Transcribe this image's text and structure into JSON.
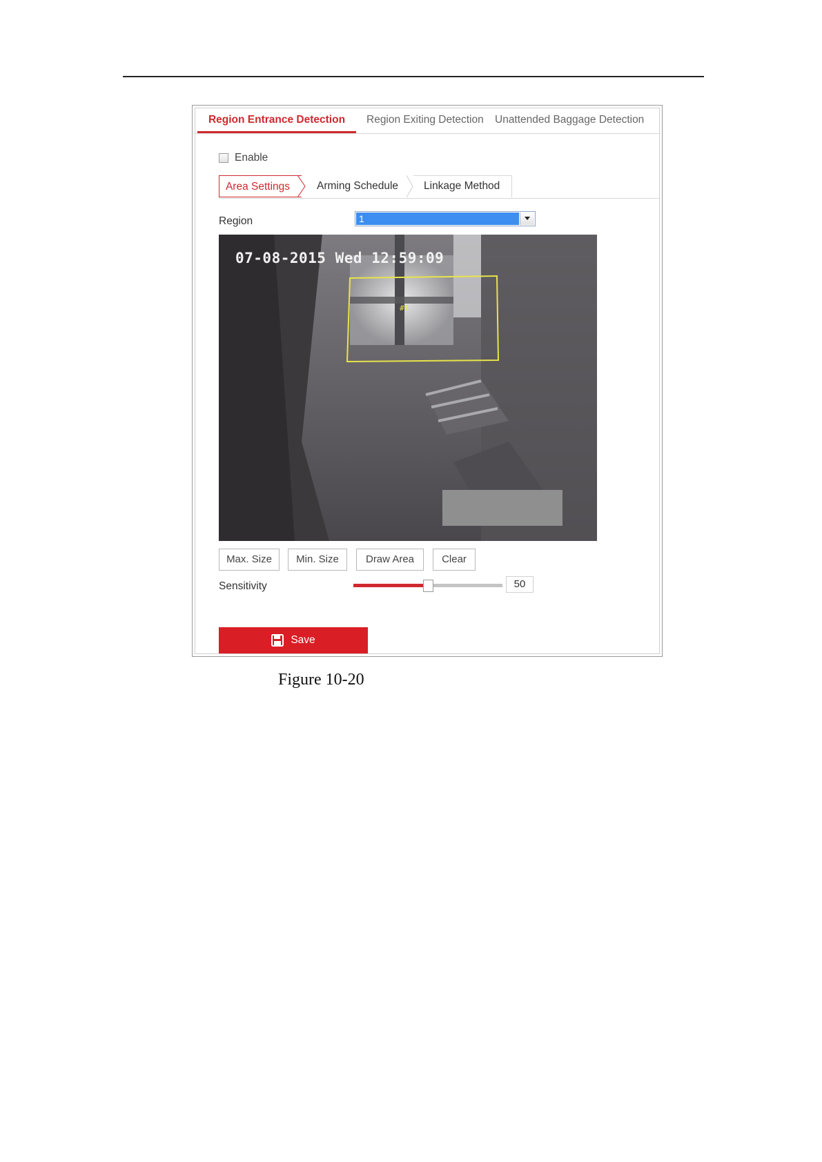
{
  "tabs": [
    {
      "label": "Region Entrance Detection",
      "active": true
    },
    {
      "label": "Region Exiting Detection",
      "active": false
    },
    {
      "label": "Unattended Baggage Detection",
      "active": false
    }
  ],
  "enable": {
    "label": "Enable",
    "checked": false
  },
  "subtabs": [
    {
      "label": "Area Settings",
      "active": true
    },
    {
      "label": "Arming Schedule",
      "active": false
    },
    {
      "label": "Linkage Method",
      "active": false
    }
  ],
  "region": {
    "label": "Region",
    "value": "1"
  },
  "video": {
    "timestamp": "07-08-2015 Wed 12:59:09",
    "rule_label": "#1"
  },
  "buttons": {
    "max_size": "Max. Size",
    "min_size": "Min. Size",
    "draw_area": "Draw Area",
    "clear": "Clear"
  },
  "sensitivity": {
    "label": "Sensitivity",
    "value": "50",
    "level": 50,
    "min": 0,
    "max": 100
  },
  "save": {
    "label": "Save",
    "icon": "floppy-disk-icon"
  },
  "caption": "Figure 10-20",
  "colors": {
    "accent": "#d0282e",
    "save_bg": "#d91e26",
    "select_highlight": "#3c8ef0",
    "region_box": "#e8e44a"
  }
}
